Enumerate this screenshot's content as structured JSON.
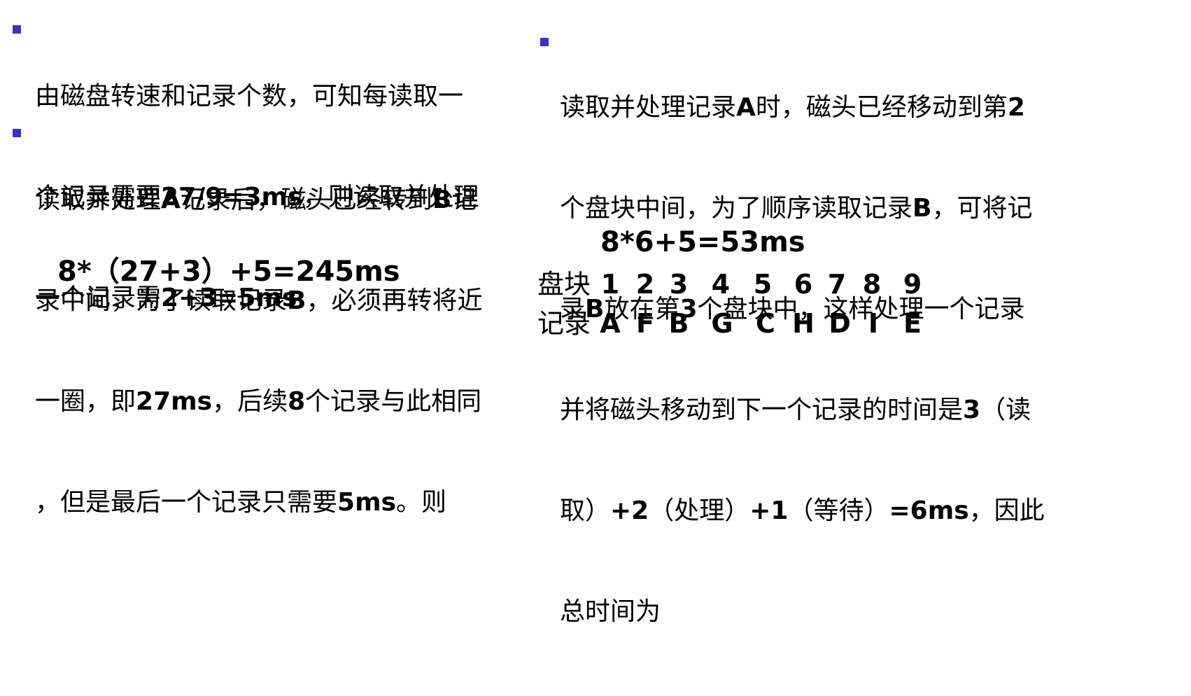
{
  "bullet_color": "#3333cc",
  "left": {
    "paragraph1": {
      "lines": [
        [
          "由磁盘转速和记录个数，可知每读取一"
        ],
        [
          "个记录需要",
          "27/9=3ms",
          "，则读取并处理"
        ],
        [
          "一个记录需",
          "2+3=5ms"
        ]
      ]
    },
    "paragraph2": {
      "lines": [
        [
          "读取并处理",
          "A",
          "记录后，磁头已经转到",
          "B",
          "记"
        ],
        [
          "录中间，为了读取记录",
          "B",
          "，必须再转将近"
        ],
        [
          "一圈，即",
          "27ms",
          "，后续",
          "8",
          "个记录与此相同"
        ],
        [
          "，但是最后一个记录只需要",
          "5ms",
          "。则"
        ]
      ]
    },
    "formula": "8*（27+3）+5=245ms"
  },
  "right": {
    "paragraph1": {
      "lines": [
        [
          "读取并处理记录",
          "A",
          "时，磁头已经移动到第",
          "2"
        ],
        [
          "个盘块中间，为了顺序读取记录",
          "B",
          "，可将记"
        ],
        [
          "录",
          "B",
          "放在第",
          "3",
          "个盘块中，这样处理一个记录"
        ],
        [
          "并将磁头移动到下一个记录的时间是",
          "3",
          "（读"
        ],
        [
          "取）",
          "+2",
          "（处理）",
          "+1",
          "（等待）",
          "=6ms",
          "，因此"
        ],
        [
          "总时间为"
        ]
      ]
    },
    "formula": "8*6+5=53ms",
    "block_label": "盘块",
    "record_label": "记录",
    "blocks": [
      "1",
      "2",
      "3",
      "4",
      "5",
      "6",
      "7",
      "8",
      "9"
    ],
    "records": [
      "A",
      "F",
      "B",
      "G",
      "C",
      "H",
      "D",
      "I",
      "E"
    ]
  }
}
